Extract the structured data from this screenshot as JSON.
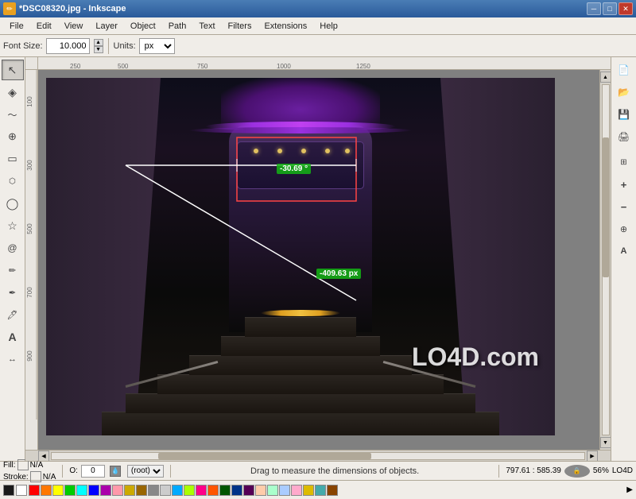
{
  "titleBar": {
    "icon": "✏",
    "title": "*DSC08320.jpg - Inkscape",
    "minBtn": "─",
    "maxBtn": "□",
    "closeBtn": "✕"
  },
  "menuBar": {
    "items": [
      "File",
      "Edit",
      "View",
      "Layer",
      "Object",
      "Path",
      "Text",
      "Filters",
      "Extensions",
      "Help"
    ]
  },
  "toolbar": {
    "fontSizeLabel": "Font Size:",
    "fontSizeValue": "10.000",
    "unitsLabel": "Units:",
    "unitsValue": "px"
  },
  "ruler": {
    "marks": [
      "250",
      "300",
      "750",
      "1000",
      "1250"
    ]
  },
  "canvas": {
    "measureAngle": "-30.69 °",
    "measureDistance": "-409.63 px",
    "watermark": "LO4D.com"
  },
  "statusBar": {
    "fillLabel": "Fill:",
    "fillValue": "N/A",
    "strokeLabel": "Stroke:",
    "strokeValue": "N/A",
    "opacityLabel": "O:",
    "opacityValue": "0",
    "layerValue": "(root)",
    "dragMessage": "Drag to measure the dimensions of objects.",
    "coords": "797.61",
    "coords2": "585.39",
    "zoomLabel": "56%"
  },
  "tools": {
    "left": [
      {
        "name": "select",
        "icon": "↖",
        "label": "Select Tool"
      },
      {
        "name": "node",
        "icon": "◇",
        "label": "Node Tool"
      },
      {
        "name": "tweak",
        "icon": "〜",
        "label": "Tweak Tool"
      },
      {
        "name": "zoom",
        "icon": "🔍",
        "label": "Zoom Tool"
      },
      {
        "name": "rect",
        "icon": "▭",
        "label": "Rectangle Tool"
      },
      {
        "name": "3d-box",
        "icon": "⬡",
        "label": "3D Box Tool"
      },
      {
        "name": "ellipse",
        "icon": "◯",
        "label": "Ellipse Tool"
      },
      {
        "name": "star",
        "icon": "☆",
        "label": "Star Tool"
      },
      {
        "name": "spiral",
        "icon": "🌀",
        "label": "Spiral Tool"
      },
      {
        "name": "pencil",
        "icon": "✏",
        "label": "Pencil Tool"
      },
      {
        "name": "pen",
        "icon": "✒",
        "label": "Pen Tool"
      },
      {
        "name": "calligraphy",
        "icon": "𝒞",
        "label": "Calligraphy Tool"
      },
      {
        "name": "text",
        "icon": "A",
        "label": "Text Tool"
      },
      {
        "name": "measure",
        "icon": "↔",
        "label": "Measure Tool"
      }
    ],
    "right": [
      {
        "name": "new-doc",
        "icon": "📄",
        "label": "New"
      },
      {
        "name": "open-doc",
        "icon": "📂",
        "label": "Open"
      },
      {
        "name": "save-doc",
        "icon": "💾",
        "label": "Save"
      },
      {
        "name": "print-doc",
        "icon": "🖨",
        "label": "Print"
      },
      {
        "name": "zoom-fit",
        "icon": "⊞",
        "label": "Zoom to Fit"
      },
      {
        "name": "zoom-in",
        "icon": "+",
        "label": "Zoom In"
      },
      {
        "name": "zoom-out",
        "icon": "−",
        "label": "Zoom Out"
      }
    ]
  }
}
